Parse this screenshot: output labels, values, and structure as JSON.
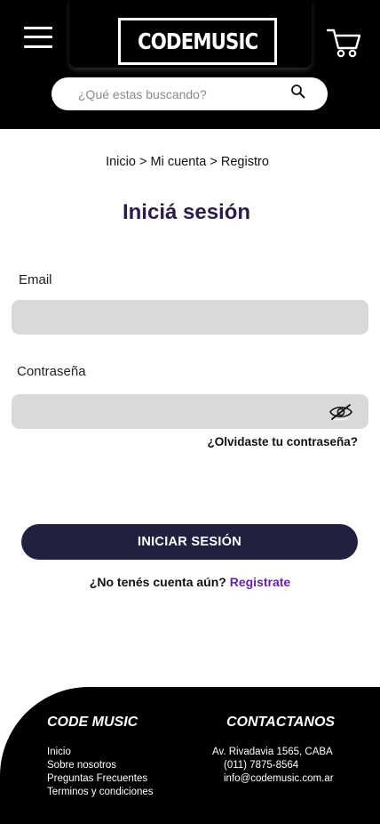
{
  "header": {
    "menu_icon": "hamburger-menu-icon",
    "logo_text": "CODEMUSIC",
    "cart_icon": "shopping-cart-icon",
    "search": {
      "placeholder": "¿Qué estas buscando?",
      "value": "",
      "icon": "search-icon"
    }
  },
  "breadcrumb": {
    "items": [
      "Inicio",
      "Mi cuenta",
      "Registro"
    ],
    "separator": ">"
  },
  "page_title": "Iniciá sesión",
  "form": {
    "email_label": "Email",
    "email_value": "",
    "password_label": "Contraseña",
    "password_value": "",
    "password_toggle_icon": "eye-slash-icon",
    "forgot_link": "¿Olvidaste tu contraseña?",
    "submit_label": "INICIAR SESIÓN",
    "register_prompt": "¿No tenés cuenta aún?",
    "register_link": "Registrate"
  },
  "footer": {
    "brand_title": "CODE MUSIC",
    "links": [
      "Inicio",
      "Sobre nosotros",
      "Preguntas Frecuentes",
      "Terminos y condiciones"
    ],
    "contact_title": "CONTACTANOS",
    "address": "Av. Rivadavia 1565, CABA",
    "phone": "(011) 7875-8564",
    "email": "info@codemusic.com.ar"
  },
  "colors": {
    "header_bg": "#000000",
    "title": "#2b1d4a",
    "button_bg": "#22203f",
    "link_accent": "#6b21a8",
    "field_bg": "#d9d9d9"
  }
}
